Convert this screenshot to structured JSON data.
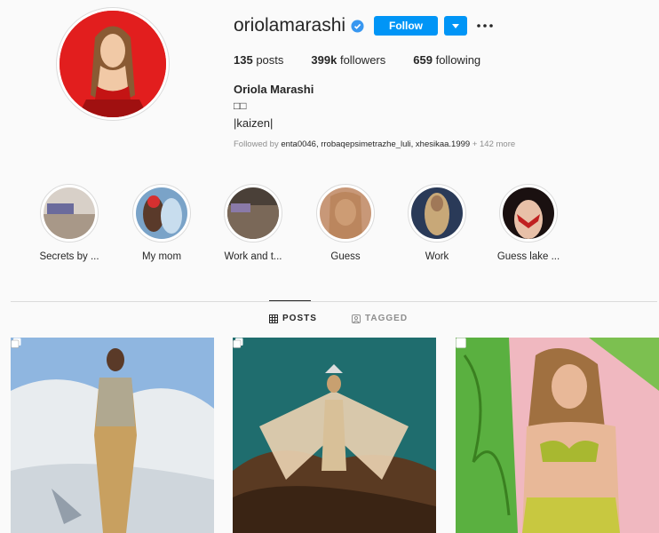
{
  "profile": {
    "username": "oriolamarashi",
    "follow_label": "Follow",
    "stats": [
      {
        "value": "135",
        "label": "posts"
      },
      {
        "value": "399k",
        "label": "followers"
      },
      {
        "value": "659",
        "label": "following"
      }
    ],
    "full_name": "Oriola Marashi",
    "bio_line1": "□□",
    "bio_line2": "|kaizen|",
    "followed_by_prefix": "Followed by ",
    "followed_by_names": "enta0046, rrobaqepsimetrazhe_luli, xhesikaa.1999",
    "followed_by_more": " + 142 more"
  },
  "highlights": [
    {
      "label": "Secrets by ..."
    },
    {
      "label": "My mom"
    },
    {
      "label": "Work and t..."
    },
    {
      "label": "Guess"
    },
    {
      "label": "Work"
    },
    {
      "label": "Guess lake ..."
    }
  ],
  "tabs": {
    "posts": "POSTS",
    "tagged": "TAGGED"
  },
  "colors": {
    "accent": "#0095f6",
    "avatar_bg": "#e21e1e",
    "text": "#262626",
    "muted": "#8e8e8e"
  }
}
